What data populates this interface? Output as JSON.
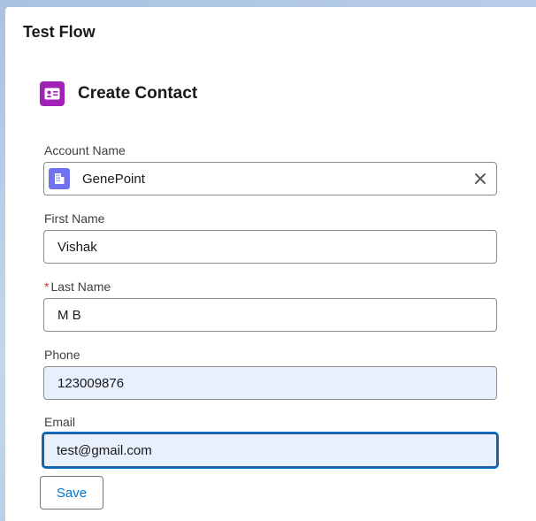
{
  "modal": {
    "title": "Test Flow"
  },
  "card": {
    "title": "Create Contact",
    "icon": "contact-card-icon"
  },
  "fields": {
    "account": {
      "label": "Account Name",
      "value": "GenePoint",
      "icon": "building-icon"
    },
    "first_name": {
      "label": "First Name",
      "value": "Vishak"
    },
    "last_name": {
      "label": "Last Name",
      "required_marker": "*",
      "value": "M B"
    },
    "phone": {
      "label": "Phone",
      "value": "123009876"
    },
    "email": {
      "label": "Email",
      "value": "test@gmail.com"
    }
  },
  "actions": {
    "save_label": "Save"
  },
  "colors": {
    "card_icon_bg": "#a020b8",
    "lookup_icon_bg": "#7172f0",
    "focus_border": "#1b5f9e",
    "autofill_bg": "#e8f0fe",
    "link_blue": "#0176d3",
    "required_red": "#c23934"
  }
}
